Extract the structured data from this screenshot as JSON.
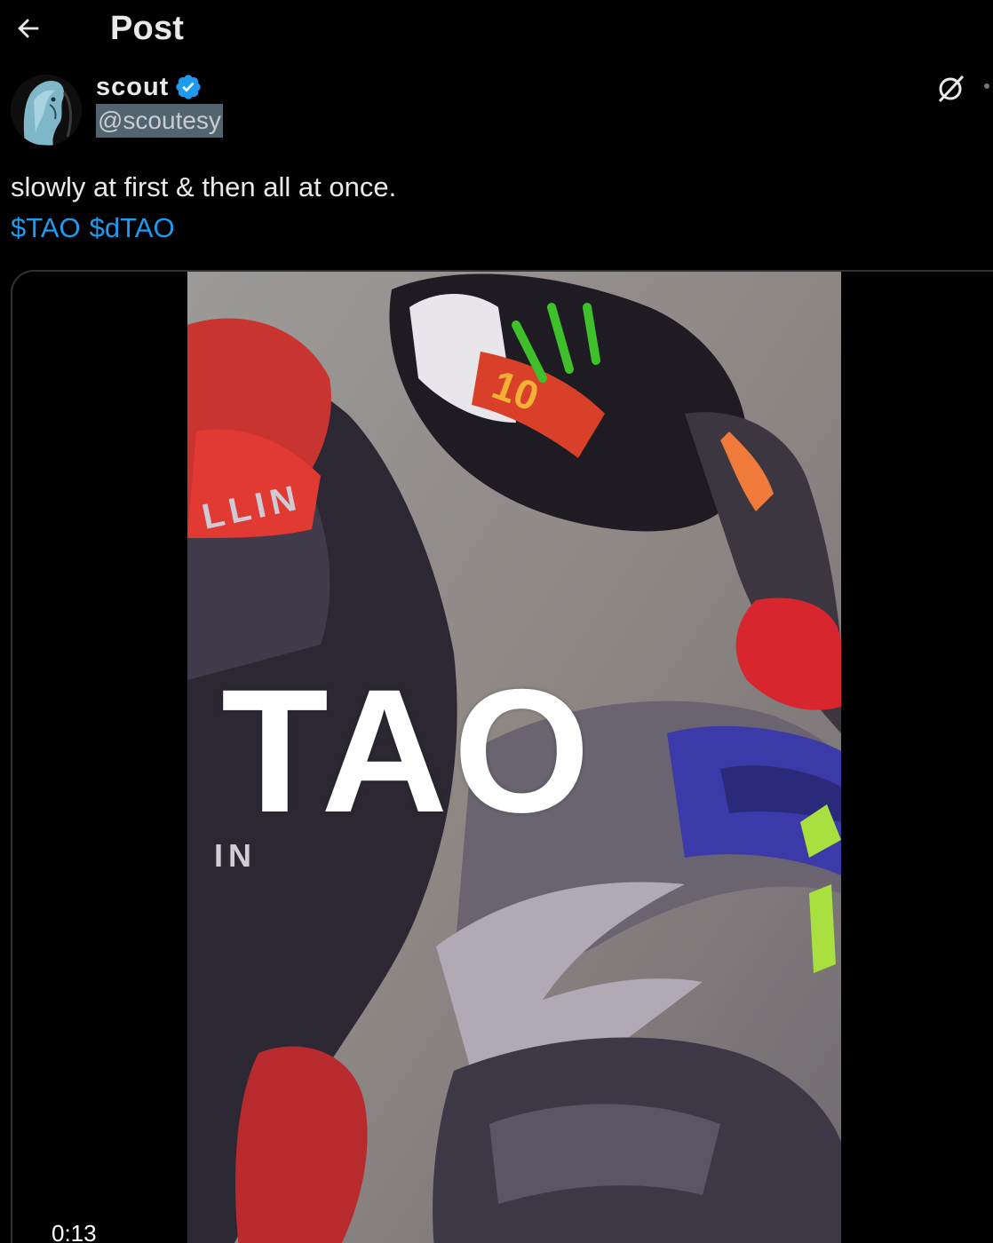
{
  "header": {
    "title": "Post",
    "back_icon": "arrow-left-icon"
  },
  "author": {
    "display_name": "scout",
    "handle": "@scoutesy",
    "verified": true,
    "verified_color": "#1d9bf0"
  },
  "post": {
    "text": "slowly at first & then all at once.",
    "cashtags": [
      "$TAO",
      "$dTAO"
    ],
    "link_color": "#1d9bf0"
  },
  "media": {
    "type": "video",
    "overlay_text": "TAO",
    "duration": "0:13"
  },
  "actions": {
    "grok_icon": "grok-icon",
    "more_icon": "more-icon"
  }
}
